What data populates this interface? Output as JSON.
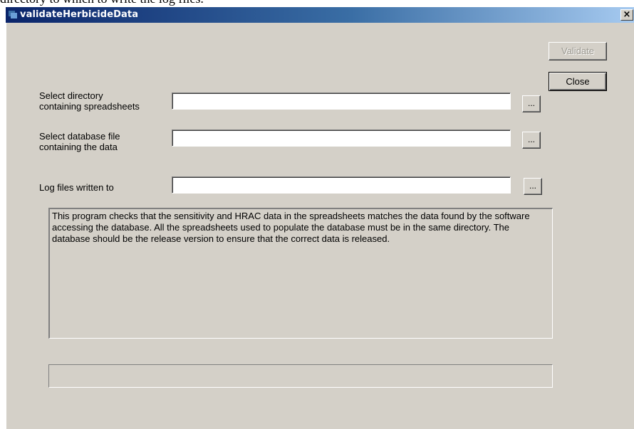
{
  "background_text": "directory to which to write the log files.",
  "window": {
    "title": "validateHerbicideData",
    "close_glyph": "×"
  },
  "buttons": {
    "validate": "Validate",
    "close": "Close",
    "browse": "..."
  },
  "fields": [
    {
      "label": "Select directory\ncontaining spreadsheets",
      "value": ""
    },
    {
      "label": "Select database file\ncontaining the  data",
      "value": ""
    },
    {
      "label": "Log files written to",
      "value": ""
    }
  ],
  "description": "This program checks that the sensitivity and HRAC data in the spreadsheets matches the data found by the software accessing the database. All the spreadsheets used to populate the database must be in the same directory. The database should be the release version to ensure that the correct data is released.",
  "progress": {
    "fraction": 0
  },
  "icons": {
    "app": "app-icon",
    "close": "close-icon",
    "browse": "ellipsis-icon"
  },
  "colors": {
    "face": "#d4d0c8",
    "title_start": "#0a246a",
    "title_end": "#a6caf0"
  }
}
